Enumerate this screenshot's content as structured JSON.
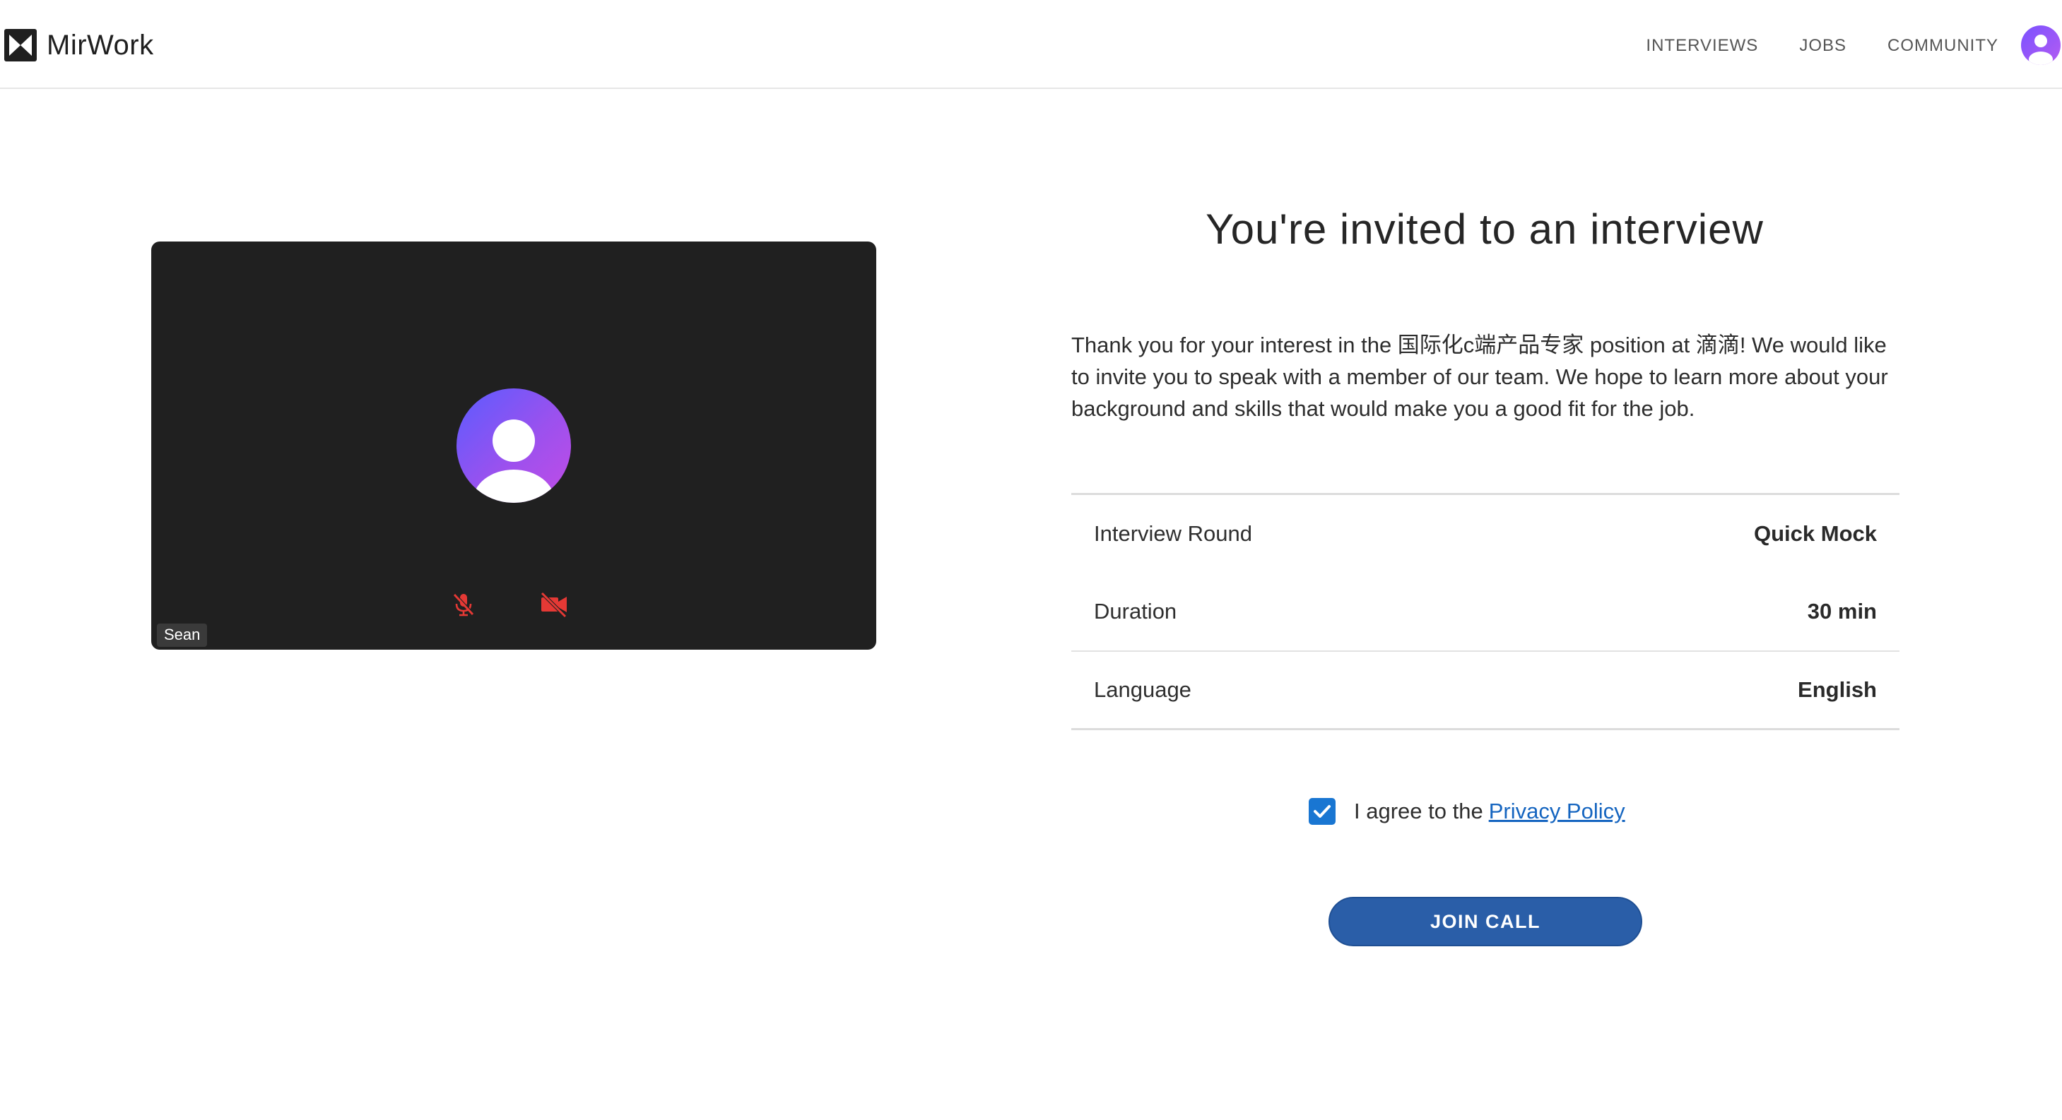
{
  "header": {
    "brand_name": "MirWork",
    "logo_icon": "mirwork-logo-icon",
    "nav": [
      {
        "label": "INTERVIEWS"
      },
      {
        "label": "JOBS"
      },
      {
        "label": "COMMUNITY"
      }
    ],
    "avatar_icon": "user-avatar-icon"
  },
  "preview": {
    "participant_name": "Sean",
    "mic_state": "muted",
    "camera_state": "off",
    "control_color": "#e53935"
  },
  "invite": {
    "title": "You're invited to an interview",
    "message": "Thank you for your interest in the 国际化c端产品专家 position at 滴滴! We would like to invite you to speak with a member of our team. We hope to learn more about your background and skills that would make you a good fit for the job.",
    "details": [
      {
        "label": "Interview Round",
        "value": "Quick Mock"
      },
      {
        "label": "Duration",
        "value": "30 min"
      },
      {
        "label": "Language",
        "value": "English"
      }
    ],
    "agree_prefix": "I agree to the",
    "agree_link": "Privacy Policy",
    "agree_checked": true,
    "join_label": "JOIN CALL"
  },
  "colors": {
    "accent": "#2a5ea8",
    "checkbox": "#1976d2",
    "link": "#1565c0",
    "video_bg": "#202020"
  }
}
